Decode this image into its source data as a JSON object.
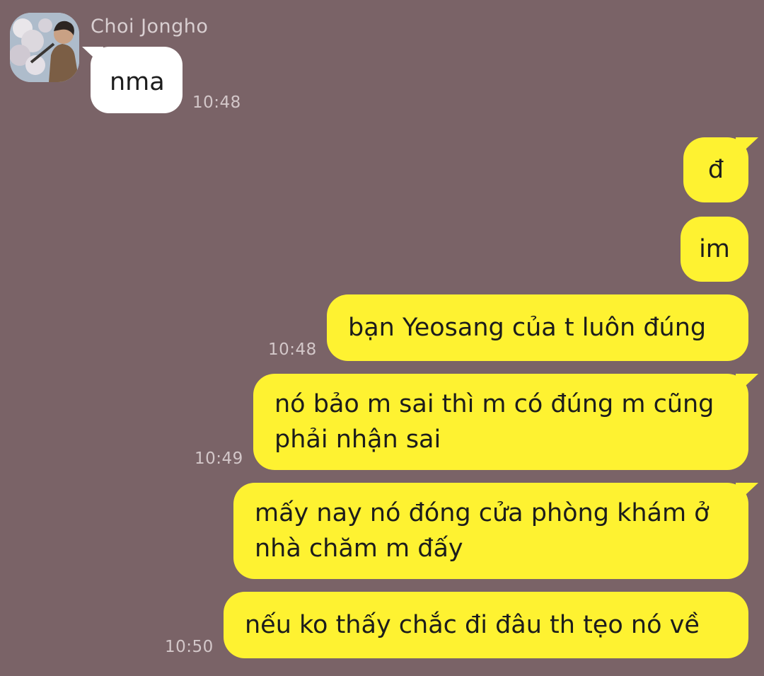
{
  "contact": {
    "name": "Choi Jongho"
  },
  "incoming": [
    {
      "text": "nma",
      "time": "10:48"
    }
  ],
  "outgoing": [
    {
      "text": "đ",
      "time": ""
    },
    {
      "text": "im",
      "time": ""
    },
    {
      "text": "bạn Yeosang của t luôn đúng",
      "time": "10:48"
    },
    {
      "text": "nó bảo m sai thì m có đúng m cũng phải nhận sai",
      "time": "10:49"
    },
    {
      "text": "mấy nay nó đóng cửa phòng khám ở nhà chăm m đấy",
      "time": ""
    },
    {
      "text": "nếu ko thấy chắc đi đâu th tẹo nó về",
      "time": "10:50"
    }
  ],
  "colors": {
    "background": "#7a6367",
    "outgoing_bubble": "#fef231",
    "incoming_bubble": "#ffffff"
  }
}
